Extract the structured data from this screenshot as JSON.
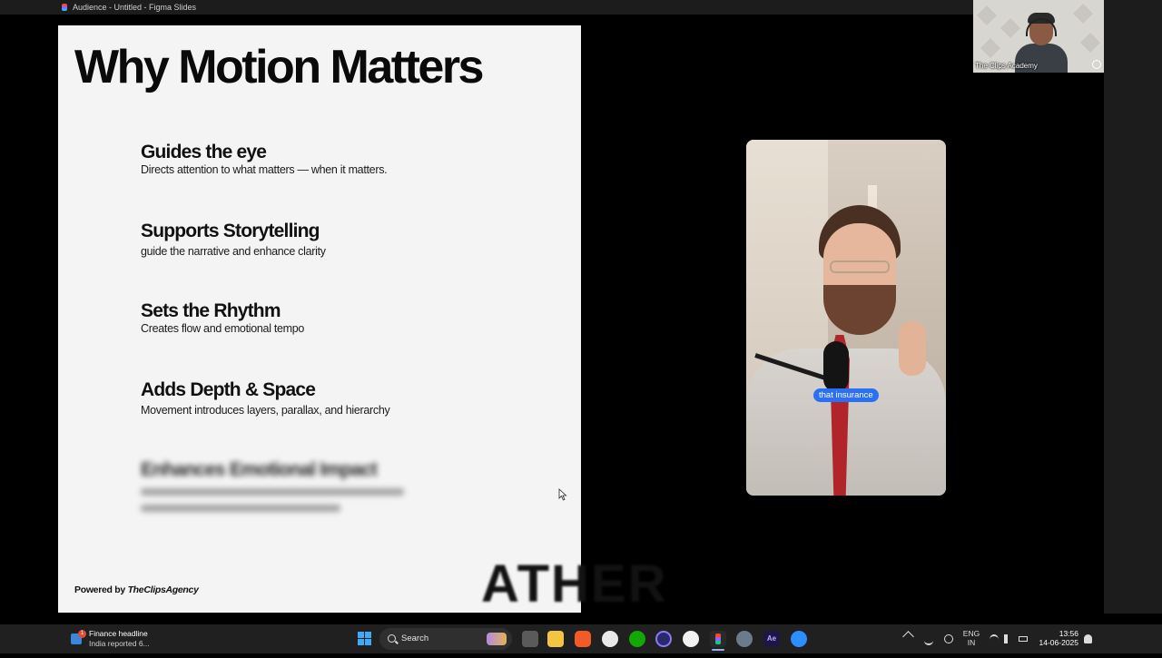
{
  "window": {
    "title": "Audience - Untitled - Figma Slides"
  },
  "slide": {
    "title": "Why Motion Matters",
    "points": [
      {
        "heading": "Guides the eye",
        "text": "Directs attention to what matters — when it matters."
      },
      {
        "heading": "Supports Storytelling",
        "text": "guide the narrative and enhance clarity"
      },
      {
        "heading": "Sets the Rhythm",
        "text": "Creates flow and emotional tempo"
      },
      {
        "heading": "Adds Depth & Space",
        "text": "Movement introduces layers, parallax, and hierarchy"
      },
      {
        "heading": "Enhances Emotional Impact",
        "text": ""
      }
    ],
    "powered_prefix": "Powered by ",
    "powered_brand": "TheClipsAgency"
  },
  "video": {
    "caption": "that insurance"
  },
  "watermark": "ATHER",
  "webcam": {
    "label": "The Clips Academy"
  },
  "taskbar": {
    "news_title": "Finance headline",
    "news_sub": "India reported 6...",
    "news_badge": "1",
    "search_label": "Search",
    "lang_1": "ENG",
    "lang_2": "IN",
    "time": "13:56",
    "date": "14-06-2025",
    "apps": [
      "file-explorer-icon",
      "folder-icon",
      "brave-icon",
      "slack-icon",
      "upwork-icon",
      "circle-app-icon",
      "d-app-icon",
      "figma-icon",
      "settings-icon",
      "after-effects-icon",
      "zoom-icon"
    ]
  },
  "colors": {
    "slide_bg": "#f4f4f4",
    "caption_pill": "#2b6ff2",
    "taskbar": "#202020"
  }
}
